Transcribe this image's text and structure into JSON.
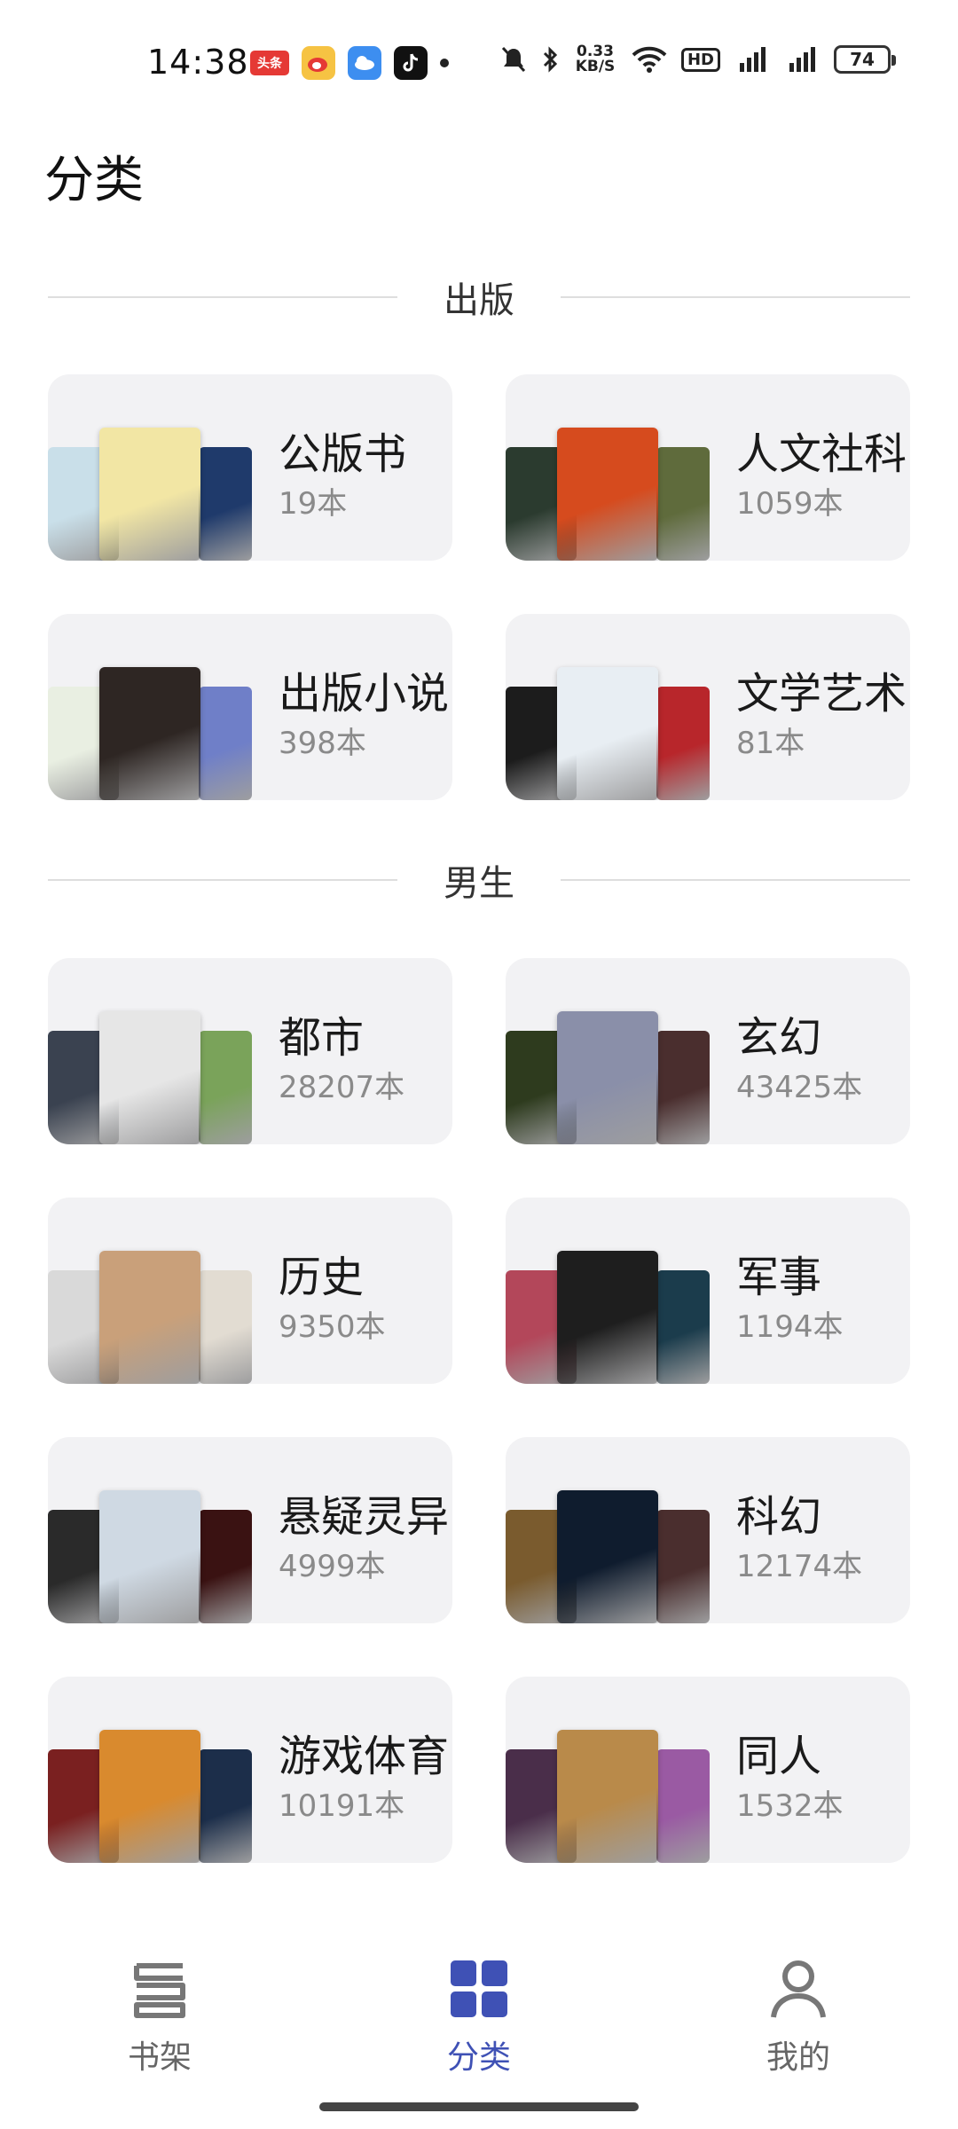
{
  "status_bar": {
    "time": "14:38",
    "app_icons": [
      "toutiao-icon",
      "weibo-icon",
      "weather-icon",
      "tiktok-icon"
    ],
    "net_speed": "0.33 KB/S",
    "battery": "74"
  },
  "page_title": "分类",
  "sections": [
    {
      "title": "出版",
      "cards": [
        {
          "name": "公版书",
          "count": "19本",
          "covers": [
            "#c9dfe9",
            "#f2e6a4",
            "#1f3a6b"
          ]
        },
        {
          "name": "人文社科",
          "count": "1059本",
          "covers": [
            "#2b3b2f",
            "#d64b1e",
            "#5f6b3c"
          ]
        },
        {
          "name": "出版小说",
          "count": "398本",
          "covers": [
            "#e9efe2",
            "#2e2623",
            "#6f7fc8"
          ]
        },
        {
          "name": "文学艺术",
          "count": "81本",
          "covers": [
            "#1c1c1c",
            "#e8eef3",
            "#b8262b"
          ]
        }
      ]
    },
    {
      "title": "男生",
      "cards": [
        {
          "name": "都市",
          "count": "28207本",
          "covers": [
            "#3a4250",
            "#e6e6e6",
            "#7aa35a"
          ]
        },
        {
          "name": "玄幻",
          "count": "43425本",
          "covers": [
            "#2e3b1e",
            "#8a8fa9",
            "#4a2e2e"
          ]
        },
        {
          "name": "历史",
          "count": "9350本",
          "covers": [
            "#d9d9d9",
            "#c9a07a",
            "#e2dcd2"
          ]
        },
        {
          "name": "军事",
          "count": "1194本",
          "covers": [
            "#b3475a",
            "#1e1e1e",
            "#1b3c4c"
          ]
        },
        {
          "name": "悬疑灵异",
          "count": "4999本",
          "covers": [
            "#2a2a2a",
            "#cfd9e3",
            "#3a1212"
          ]
        },
        {
          "name": "科幻",
          "count": "12174本",
          "covers": [
            "#7a5b2e",
            "#0f1c2e",
            "#4a2e2e"
          ]
        },
        {
          "name": "游戏体育",
          "count": "10191本",
          "covers": [
            "#7a2020",
            "#d98a2e",
            "#1c2e4a"
          ]
        },
        {
          "name": "同人",
          "count": "1532本",
          "covers": [
            "#4a2e4a",
            "#b98a4a",
            "#9a5aa3"
          ]
        }
      ]
    }
  ],
  "nav": [
    {
      "label": "书架",
      "icon": "bookshelf-icon",
      "active": false
    },
    {
      "label": "分类",
      "icon": "category-grid-icon",
      "active": true
    },
    {
      "label": "我的",
      "icon": "profile-icon",
      "active": false
    }
  ],
  "colors": {
    "accent": "#3f51b5",
    "card_bg": "#f2f2f4"
  }
}
